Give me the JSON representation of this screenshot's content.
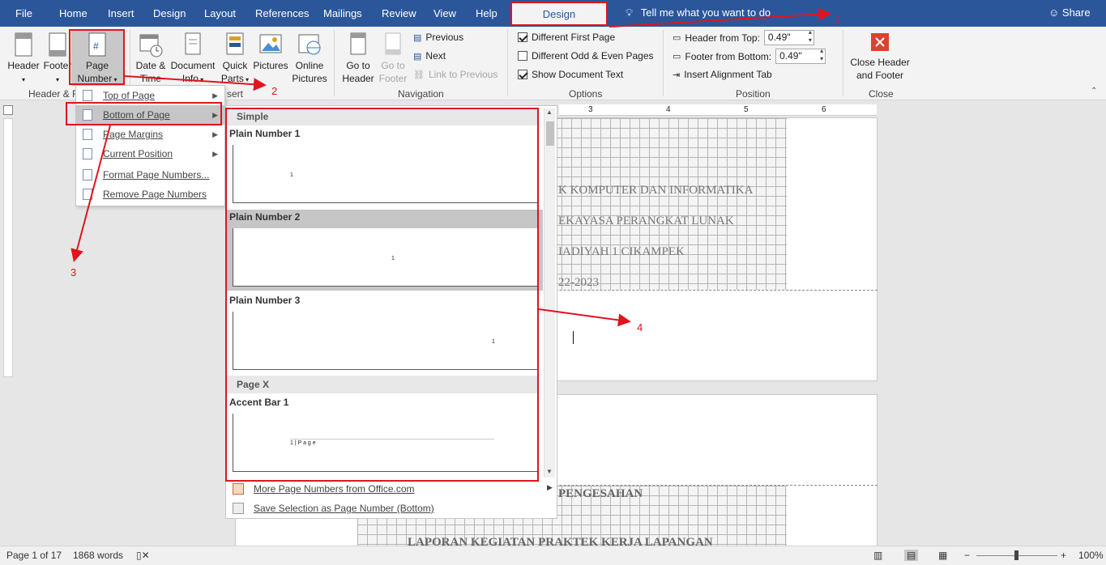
{
  "tabs": [
    "File",
    "Home",
    "Insert",
    "Design",
    "Layout",
    "References",
    "Mailings",
    "Review",
    "View",
    "Help"
  ],
  "active_tab": "Design",
  "tell_me": "Tell me what you want to do",
  "share": "Share",
  "ribbon": {
    "header": "Header",
    "footer": "Footer",
    "page_number_1": "Page",
    "page_number_2": "Number",
    "date_1": "Date &",
    "date_2": "Time",
    "docinfo_1": "Document",
    "docinfo_2": "Info",
    "quick_1": "Quick",
    "quick_2": "Parts",
    "pictures": "Pictures",
    "online_1": "Online",
    "online_2": "Pictures",
    "goto_header_1": "Go to",
    "goto_header_2": "Header",
    "goto_footer_1": "Go to",
    "goto_footer_2": "Footer",
    "previous": "Previous",
    "next": "Next",
    "link_prev": "Link to Previous",
    "diff_first": "Different First Page",
    "diff_odd_even": "Different Odd & Even Pages",
    "show_doc": "Show Document Text",
    "header_from_top": "Header from Top:",
    "header_from_top_value": "0.49\"",
    "footer_from_bottom": "Footer from Bottom:",
    "footer_from_bottom_value": "0.49\"",
    "insert_align_tab": "Insert Alignment Tab",
    "close_1": "Close Header",
    "close_2": "and Footer",
    "group_header_footer": "Header & F",
    "group_insert": "sert",
    "group_navigation": "Navigation",
    "group_options": "Options",
    "group_position": "Position",
    "group_close": "Close"
  },
  "menu": {
    "items": [
      "Top of Page",
      "Bottom of Page",
      "Page Margins",
      "Current Position",
      "Format Page Numbers...",
      "Remove Page Numbers"
    ]
  },
  "gallery": {
    "section_simple": "Simple",
    "plain1": "Plain Number 1",
    "plain2": "Plain Number 2",
    "plain3": "Plain Number 3",
    "section_pagex": "Page X",
    "accent1": "Accent Bar 1",
    "num": "1",
    "accent_text": "1 | P a g e",
    "more": "More Page Numbers from Office.com",
    "save": "Save Selection as Page Number (Bottom)"
  },
  "document": {
    "line1": "K KOMPUTER DAN INFORMATIKA",
    "line2": "EKAYASA PERANGKAT LUNAK",
    "line3": "IADIYAH 1 CIKAMPEK",
    "line4": "22-2023",
    "pengesahan": "PENGESAHAN",
    "laporan": "LAPORAN KEGIATAN PRAKTEK KERJA LAPANGAN"
  },
  "ruler_numbers": [
    "3",
    "4",
    "5",
    "6"
  ],
  "status": {
    "page": "Page 1 of 17",
    "words": "1868 words",
    "zoom": "100%"
  },
  "annotations": [
    "1",
    "2",
    "3",
    "4"
  ],
  "colors": {
    "accent": "#2b579a",
    "annotation": "#e0141e"
  }
}
